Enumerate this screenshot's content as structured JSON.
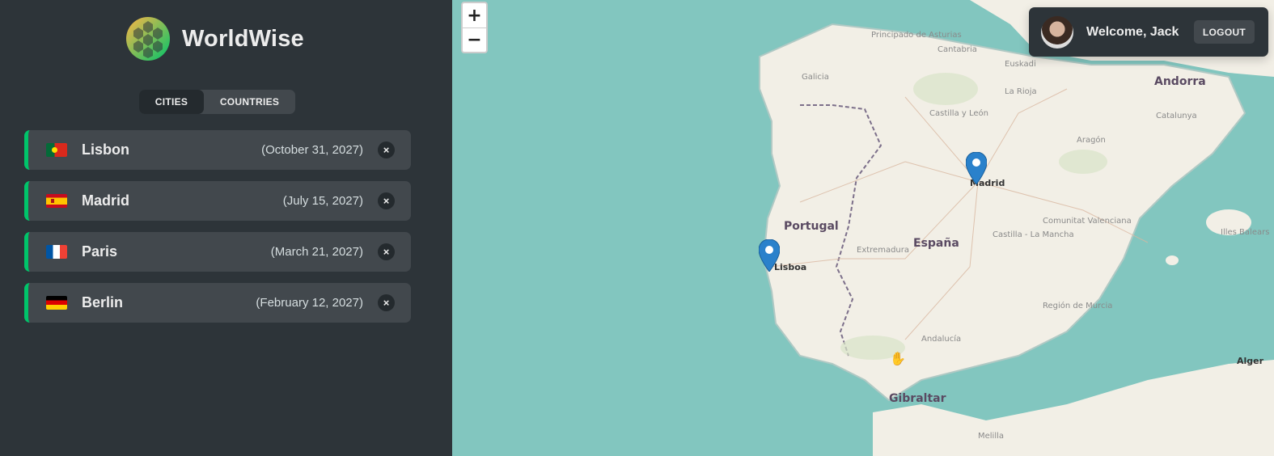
{
  "app": {
    "name": "WorldWise"
  },
  "tabs": [
    {
      "label": "CITIES",
      "active": true
    },
    {
      "label": "COUNTRIES",
      "active": false
    }
  ],
  "cities": [
    {
      "name": "Lisbon",
      "date": "(October 31, 2027)",
      "flag": "portugal-flag",
      "delete": "×"
    },
    {
      "name": "Madrid",
      "date": "(July 15, 2027)",
      "flag": "spain-flag",
      "delete": "×"
    },
    {
      "name": "Paris",
      "date": "(March 21, 2027)",
      "flag": "france-flag",
      "delete": "×"
    },
    {
      "name": "Berlin",
      "date": "(February 12, 2027)",
      "flag": "germany-flag",
      "delete": "×"
    }
  ],
  "map": {
    "zoom_in": "+",
    "zoom_out": "−",
    "labels": {
      "portugal": "Portugal",
      "espana": "España",
      "madrid": "Madrid",
      "lisboa": "Lisboa",
      "gibraltar": "Gibraltar",
      "andorra": "Andorra",
      "alger": "Alger",
      "asturias": "Principado de Asturias",
      "cantabria": "Cantabria",
      "euskadi": "Euskadi",
      "galicia": "Galicia",
      "larioja": "La Rioja",
      "castilla_leon": "Castilla y León",
      "aragon": "Aragón",
      "catalunya": "Catalunya",
      "extremadura": "Extremadura",
      "castilla_mancha": "Castilla - La Mancha",
      "valenciana": "Comunitat Valenciana",
      "murcia": "Región de Murcia",
      "andalucia": "Andalucía",
      "illes_balears": "Illes Balears",
      "melilla": "Melilla"
    }
  },
  "user": {
    "welcome": "Welcome, Jack",
    "logout": "LOGOUT"
  },
  "colors": {
    "accent": "#00c46a",
    "sidebar_bg": "#2d3439",
    "item_bg": "#42484d",
    "sea": "#82c6bf",
    "land": "#f2efe6",
    "marker": "#2a81cb"
  }
}
